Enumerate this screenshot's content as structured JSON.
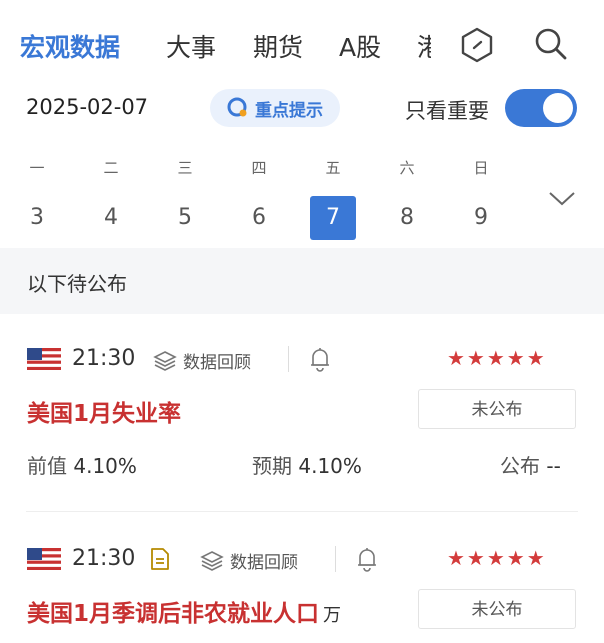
{
  "tabs": [
    {
      "label": "宏观数据",
      "active": true
    },
    {
      "label": "大事"
    },
    {
      "label": "期货"
    },
    {
      "label": "A股"
    },
    {
      "label": "港"
    }
  ],
  "date": "2025-02-07",
  "hint_button": "重点提示",
  "toggle_label": "只看重要",
  "toggle_on": true,
  "weekdays": [
    "一",
    "二",
    "三",
    "四",
    "五",
    "六",
    "日"
  ],
  "days": [
    "3",
    "4",
    "5",
    "6",
    "7",
    "8",
    "9"
  ],
  "selected_day": "7",
  "section_title": "以下待公布",
  "events": [
    {
      "time": "21:30",
      "review_label": "数据回顾",
      "stars": "★★★★★",
      "title": "美国1月失业率",
      "unit": "",
      "status": "未公布",
      "previous_label": "前值",
      "previous_value": "4.10%",
      "forecast_label": "预期",
      "forecast_value": "4.10%",
      "actual_label": "公布",
      "actual_value": "--"
    },
    {
      "time": "21:30",
      "review_label": "数据回顾",
      "stars": "★★★★★",
      "title": "美国1月季调后非农就业人口",
      "unit": "万",
      "status": "未公布"
    }
  ],
  "colors": {
    "accent": "#3a78d6",
    "title_red": "#c83131",
    "star_red": "#d33b3b"
  }
}
